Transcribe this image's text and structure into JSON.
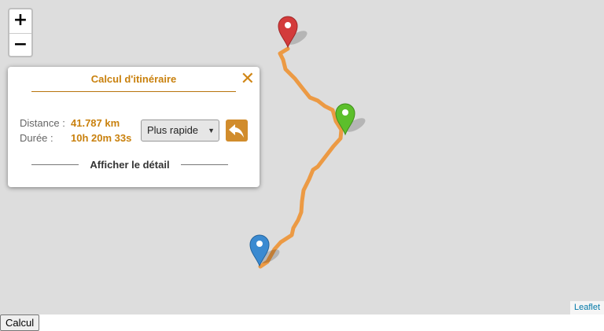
{
  "map": {
    "zoom_in_label": "+",
    "zoom_out_label": "−",
    "attribution": "Leaflet",
    "route_color": "#f0891e",
    "markers": [
      {
        "name": "end-marker",
        "color": "#d33b3b"
      },
      {
        "name": "waypoint-marker",
        "color": "#5cbf2b"
      },
      {
        "name": "start-marker",
        "color": "#3a8ad1"
      }
    ]
  },
  "panel": {
    "title": "Calcul d'itinéraire",
    "close_label": "✕",
    "distance_label": "Distance :",
    "distance_value": "41.787 km",
    "duration_label": "Durée :",
    "duration_value": "10h 20m 33s",
    "mode_selected": "Plus rapide",
    "reverse_icon": "reverse-arrow-icon",
    "detail_label": "Afficher le détail",
    "accent": "#c9810e"
  },
  "footer": {
    "button_label": "Calcul"
  }
}
